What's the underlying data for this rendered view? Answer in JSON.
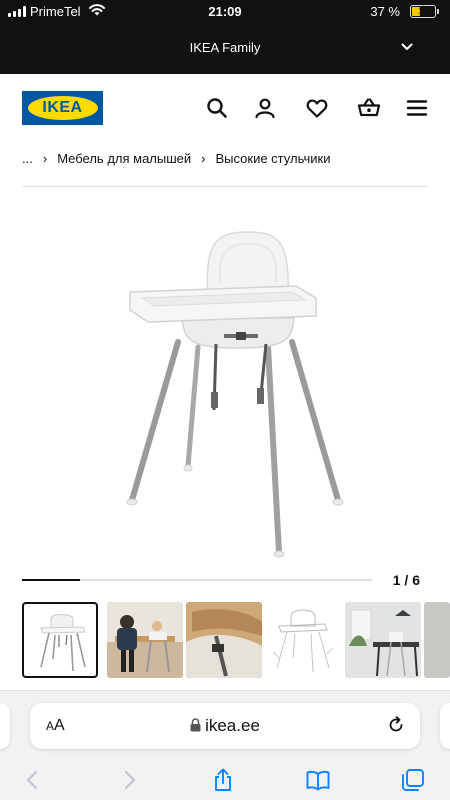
{
  "status_bar": {
    "carrier": "PrimeTel",
    "time": "21:09",
    "battery_percent": "37 %",
    "battery_level": 0.37
  },
  "family_banner": {
    "title": "IKEA Family",
    "icon": "chevron-down-icon"
  },
  "header": {
    "logo_text": "IKEA",
    "icons": [
      "search-icon",
      "user-icon",
      "heart-icon",
      "basket-icon",
      "menu-icon"
    ]
  },
  "breadcrumb": {
    "items": [
      "...",
      "Мебель для малышей",
      "Высокие стульчики"
    ],
    "separator_icon": "chevron-right-icon"
  },
  "gallery": {
    "counter": "1 / 6",
    "progress": 0.167,
    "thumbnails": [
      "high-chair-product",
      "family-at-table",
      "child-in-chair-closeup",
      "chair-line-drawing",
      "chair-in-kitchen",
      "partial-thumbnail"
    ]
  },
  "browser": {
    "text_size_label": "AA",
    "domain": "ikea.ee",
    "toolbar_icons": [
      "back-icon",
      "forward-icon",
      "share-icon",
      "bookmarks-icon",
      "tabs-icon"
    ]
  },
  "colors": {
    "ikea_blue": "#0058a3",
    "ikea_yellow": "#ffdb00",
    "ios_blue": "#0a84ff",
    "dark_bar": "#111111"
  }
}
